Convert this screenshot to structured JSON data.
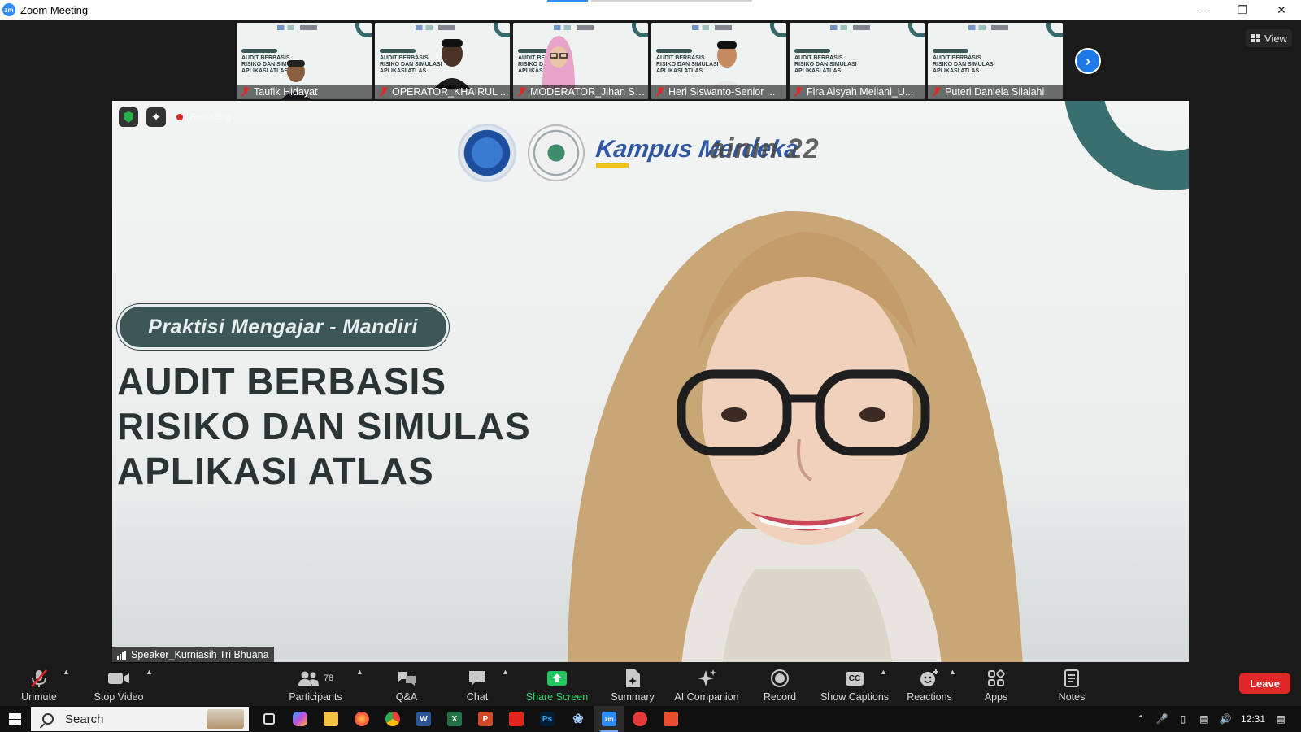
{
  "window": {
    "title": "Zoom Meeting",
    "app_icon_text": "zm",
    "controls": [
      "minimize",
      "restore",
      "close"
    ]
  },
  "thumbnails": [
    {
      "name": "Taufik Hidayat",
      "muted": true
    },
    {
      "name": "OPERATOR_KHAIRUL ...",
      "muted": true
    },
    {
      "name": "MODERATOR_Jihan Sa...",
      "muted": true
    },
    {
      "name": "Heri Siswanto-Senior ...",
      "muted": true
    },
    {
      "name": "Fira Aisyah Meilani_U...",
      "muted": true
    },
    {
      "name": "Puteri Daniela Silalahi",
      "muted": true
    }
  ],
  "view_button": {
    "label": "View",
    "icon": "grid-icon"
  },
  "next_page_icon": "chevron-right-icon",
  "main_video": {
    "recording_label": "Recording",
    "slide": {
      "brand_text": "Kampus Merdeka",
      "tag_text": "ainin 22",
      "subtitle_pill": "Praktisi Mengajar - Mandiri",
      "title_lines": [
        "AUDIT BERBASIS",
        "RISIKO DAN SIMULAS",
        "APLIKASI ATLAS"
      ]
    },
    "speaker_label": "Speaker_Kurniasih Tri Bhuana"
  },
  "toolbar": {
    "unmute": "Unmute",
    "stop_video": "Stop Video",
    "participants": "Participants",
    "participants_count": "78",
    "qa": "Q&A",
    "chat": "Chat",
    "share_screen": "Share Screen",
    "summary": "Summary",
    "ai_companion": "AI Companion",
    "record": "Record",
    "show_captions": "Show Captions",
    "reactions": "Reactions",
    "apps": "Apps",
    "notes": "Notes",
    "leave": "Leave",
    "captions_icon_text": "CC"
  },
  "taskbar": {
    "search_placeholder": "Search",
    "apps": [
      {
        "name": "task-view",
        "label": ""
      },
      {
        "name": "copilot",
        "label": ""
      },
      {
        "name": "file-explorer",
        "label": ""
      },
      {
        "name": "firefox",
        "label": ""
      },
      {
        "name": "chrome",
        "label": ""
      },
      {
        "name": "word",
        "label": "W"
      },
      {
        "name": "excel",
        "label": "X"
      },
      {
        "name": "powerpoint",
        "label": "P"
      },
      {
        "name": "acrobat",
        "label": ""
      },
      {
        "name": "photoshop",
        "label": "Ps"
      },
      {
        "name": "app-swirl",
        "label": ""
      },
      {
        "name": "zoom",
        "label": "zm"
      },
      {
        "name": "app-red",
        "label": ""
      },
      {
        "name": "app-orange",
        "label": ""
      }
    ],
    "clock": "12:31"
  },
  "colors": {
    "accent_blue": "#2d8cff",
    "leave_red": "#e02828",
    "share_green": "#23d96b",
    "slide_teal": "#2f6767"
  }
}
